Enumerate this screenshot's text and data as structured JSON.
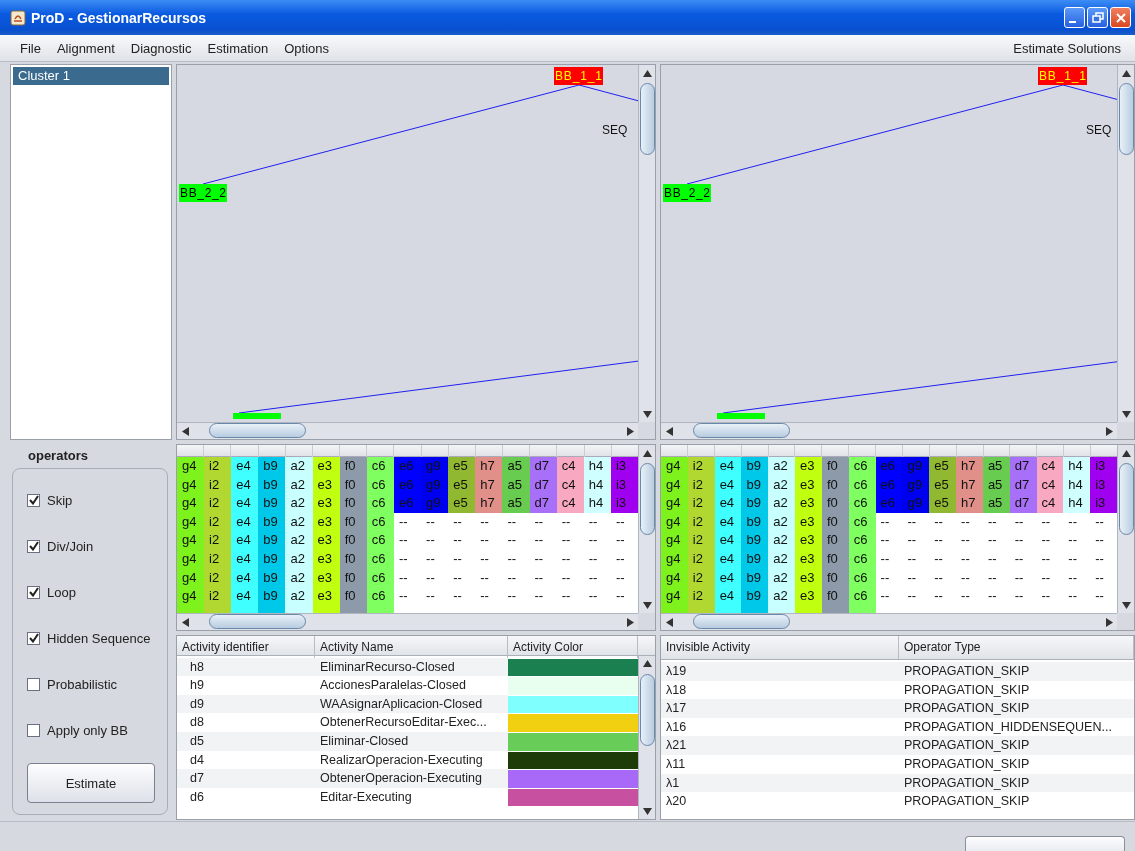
{
  "window": {
    "title": "ProD - GestionarRecursos"
  },
  "menu": {
    "items": [
      "File",
      "Alignment",
      "Diagnostic",
      "Estimation",
      "Options"
    ],
    "right": "Estimate Solutions"
  },
  "clusters": [
    {
      "label": "Cluster 1",
      "selected": true
    }
  ],
  "operators": {
    "title": "operators",
    "options": [
      {
        "label": "Skip",
        "checked": true
      },
      {
        "label": "Div/Join",
        "checked": true
      },
      {
        "label": "Loop",
        "checked": true
      },
      {
        "label": "Hidden Sequence",
        "checked": true
      },
      {
        "label": "Probabilistic",
        "checked": false
      },
      {
        "label": "Apply only BB",
        "checked": false
      }
    ],
    "button": "Estimate"
  },
  "panes": [
    {
      "diagram": {
        "nodes": [
          {
            "label": "BB_1_1",
            "kind": "root"
          },
          {
            "label": "BB_2_2",
            "kind": "block"
          },
          {
            "label": "SEQ",
            "kind": "operator"
          }
        ]
      },
      "alignment": {
        "columns": [
          {
            "color": "#7ef21c",
            "kind": "shared"
          },
          {
            "color": "#b0d830",
            "kind": "shared"
          },
          {
            "color": "#40ffff",
            "kind": "shared"
          },
          {
            "color": "#00c8e8",
            "kind": "shared"
          },
          {
            "color": "#c8ffff",
            "kind": "shared"
          },
          {
            "color": "#c0ff10",
            "kind": "shared"
          },
          {
            "color": "#8c9aaa",
            "kind": "shared"
          },
          {
            "color": "#80ff60",
            "kind": "shared"
          },
          {
            "color": "#0000ff",
            "kind": "model"
          },
          {
            "color": "#0000f0",
            "kind": "model"
          },
          {
            "color": "#90b830",
            "kind": "model"
          },
          {
            "color": "#e09088",
            "kind": "model"
          },
          {
            "color": "#68cc50",
            "kind": "model"
          },
          {
            "color": "#a870f8",
            "kind": "model"
          },
          {
            "color": "#f8a8c0",
            "kind": "model"
          },
          {
            "color": "#d0ffff",
            "kind": "model"
          },
          {
            "color": "#a000f0",
            "kind": "model"
          }
        ],
        "rows": [
          {
            "kind": "full",
            "cells": [
              "g4",
              "i2",
              "e4",
              "b9",
              "a2",
              "e3",
              "f0",
              "c6",
              "e6",
              "g9",
              "e5",
              "h7",
              "a5",
              "d7",
              "c4",
              "h4",
              "i3"
            ]
          },
          {
            "kind": "full",
            "cells": [
              "g4",
              "i2",
              "e4",
              "b9",
              "a2",
              "e3",
              "f0",
              "c6",
              "e6",
              "g9",
              "e5",
              "h7",
              "a5",
              "d7",
              "c4",
              "h4",
              "i3"
            ]
          },
          {
            "kind": "full",
            "cells": [
              "g4",
              "i2",
              "e4",
              "b9",
              "a2",
              "e3",
              "f0",
              "c6",
              "e6",
              "g9",
              "e5",
              "h7",
              "a5",
              "d7",
              "c4",
              "h4",
              "i3"
            ]
          },
          {
            "kind": "partial",
            "cells": [
              "g4",
              "i2",
              "e4",
              "b9",
              "a2",
              "e3",
              "f0",
              "c6",
              "--",
              "--",
              "--",
              "--",
              "--",
              "--",
              "--",
              "--",
              "--"
            ]
          },
          {
            "kind": "partial",
            "cells": [
              "g4",
              "i2",
              "e4",
              "b9",
              "a2",
              "e3",
              "f0",
              "c6",
              "--",
              "--",
              "--",
              "--",
              "--",
              "--",
              "--",
              "--",
              "--"
            ]
          },
          {
            "kind": "partial",
            "cells": [
              "g4",
              "i2",
              "e4",
              "b9",
              "a2",
              "e3",
              "f0",
              "c6",
              "--",
              "--",
              "--",
              "--",
              "--",
              "--",
              "--",
              "--",
              "--"
            ]
          },
          {
            "kind": "partial",
            "cells": [
              "g4",
              "i2",
              "e4",
              "b9",
              "a2",
              "e3",
              "f0",
              "c6",
              "--",
              "--",
              "--",
              "--",
              "--",
              "--",
              "--",
              "--",
              "--"
            ]
          },
          {
            "kind": "partial",
            "cells": [
              "g4",
              "i2",
              "e4",
              "b9",
              "a2",
              "e3",
              "f0",
              "c6",
              "--",
              "--",
              "--",
              "--",
              "--",
              "--",
              "--",
              "--",
              "--"
            ]
          }
        ]
      }
    },
    {
      "diagram": {
        "nodes": [
          {
            "label": "BB_1_1",
            "kind": "root"
          },
          {
            "label": "BB_2_2",
            "kind": "block"
          },
          {
            "label": "SEQ",
            "kind": "operator"
          }
        ]
      },
      "alignment": {
        "columns": [
          {
            "color": "#7ef21c",
            "kind": "shared"
          },
          {
            "color": "#b0d830",
            "kind": "shared"
          },
          {
            "color": "#40ffff",
            "kind": "shared"
          },
          {
            "color": "#00c8e8",
            "kind": "shared"
          },
          {
            "color": "#c8ffff",
            "kind": "shared"
          },
          {
            "color": "#c0ff10",
            "kind": "shared"
          },
          {
            "color": "#8c9aaa",
            "kind": "shared"
          },
          {
            "color": "#80ff60",
            "kind": "shared"
          },
          {
            "color": "#0000ff",
            "kind": "model"
          },
          {
            "color": "#0000f0",
            "kind": "model"
          },
          {
            "color": "#90b830",
            "kind": "model"
          },
          {
            "color": "#e09088",
            "kind": "model"
          },
          {
            "color": "#68cc50",
            "kind": "model"
          },
          {
            "color": "#a870f8",
            "kind": "model"
          },
          {
            "color": "#f8a8c0",
            "kind": "model"
          },
          {
            "color": "#d0ffff",
            "kind": "model"
          },
          {
            "color": "#a000f0",
            "kind": "model"
          }
        ],
        "rows": [
          {
            "kind": "full",
            "cells": [
              "g4",
              "i2",
              "e4",
              "b9",
              "a2",
              "e3",
              "f0",
              "c6",
              "e6",
              "g9",
              "e5",
              "h7",
              "a5",
              "d7",
              "c4",
              "h4",
              "i3"
            ]
          },
          {
            "kind": "full",
            "cells": [
              "g4",
              "i2",
              "e4",
              "b9",
              "a2",
              "e3",
              "f0",
              "c6",
              "e6",
              "g9",
              "e5",
              "h7",
              "a5",
              "d7",
              "c4",
              "h4",
              "i3"
            ]
          },
          {
            "kind": "full",
            "cells": [
              "g4",
              "i2",
              "e4",
              "b9",
              "a2",
              "e3",
              "f0",
              "c6",
              "e6",
              "g9",
              "e5",
              "h7",
              "a5",
              "d7",
              "c4",
              "h4",
              "i3"
            ]
          },
          {
            "kind": "partial",
            "cells": [
              "g4",
              "i2",
              "e4",
              "b9",
              "a2",
              "e3",
              "f0",
              "c6",
              "--",
              "--",
              "--",
              "--",
              "--",
              "--",
              "--",
              "--",
              "--"
            ]
          },
          {
            "kind": "partial",
            "cells": [
              "g4",
              "i2",
              "e4",
              "b9",
              "a2",
              "e3",
              "f0",
              "c6",
              "--",
              "--",
              "--",
              "--",
              "--",
              "--",
              "--",
              "--",
              "--"
            ]
          },
          {
            "kind": "partial",
            "cells": [
              "g4",
              "i2",
              "e4",
              "b9",
              "a2",
              "e3",
              "f0",
              "c6",
              "--",
              "--",
              "--",
              "--",
              "--",
              "--",
              "--",
              "--",
              "--"
            ]
          },
          {
            "kind": "partial",
            "cells": [
              "g4",
              "i2",
              "e4",
              "b9",
              "a2",
              "e3",
              "f0",
              "c6",
              "--",
              "--",
              "--",
              "--",
              "--",
              "--",
              "--",
              "--",
              "--"
            ]
          },
          {
            "kind": "partial",
            "cells": [
              "g4",
              "i2",
              "e4",
              "b9",
              "a2",
              "e3",
              "f0",
              "c6",
              "--",
              "--",
              "--",
              "--",
              "--",
              "--",
              "--",
              "--",
              "--"
            ]
          }
        ]
      }
    }
  ],
  "activity_table": {
    "columns": [
      "Activity identifier",
      "Activity Name",
      "Activity Color"
    ],
    "rows": [
      {
        "id": "h8",
        "name": "EliminarRecurso-Closed",
        "color": "#1b8050"
      },
      {
        "id": "h9",
        "name": "AccionesParalelas-Closed",
        "color": "#e8fff0"
      },
      {
        "id": "d9",
        "name": "WAAsignarAplicacion-Closed",
        "color": "#80ffff"
      },
      {
        "id": "d8",
        "name": "ObtenerRecursoEditar-Exec...",
        "color": "#f0d010"
      },
      {
        "id": "d5",
        "name": "Eliminar-Closed",
        "color": "#68cc58"
      },
      {
        "id": "d4",
        "name": "RealizarOperacion-Executing",
        "color": "#1e3c08"
      },
      {
        "id": "d7",
        "name": "ObtenerOperacion-Executing",
        "color": "#a868f8"
      },
      {
        "id": "d6",
        "name": "Editar-Executing",
        "color": "#c850a0"
      }
    ]
  },
  "invisible_table": {
    "columns": [
      "Invisible Activity",
      "Operator Type"
    ],
    "rows": [
      [
        "λ19",
        "PROPAGATION_SKIP"
      ],
      [
        "λ18",
        "PROPAGATION_SKIP"
      ],
      [
        "λ17",
        "PROPAGATION_SKIP"
      ],
      [
        "λ16",
        "PROPAGATION_HIDDENSEQUEN..."
      ],
      [
        "λ21",
        "PROPAGATION_SKIP"
      ],
      [
        "λ11",
        "PROPAGATION_SKIP"
      ],
      [
        "λ1",
        "PROPAGATION_SKIP"
      ],
      [
        "λ20",
        "PROPAGATION_SKIP"
      ]
    ]
  }
}
